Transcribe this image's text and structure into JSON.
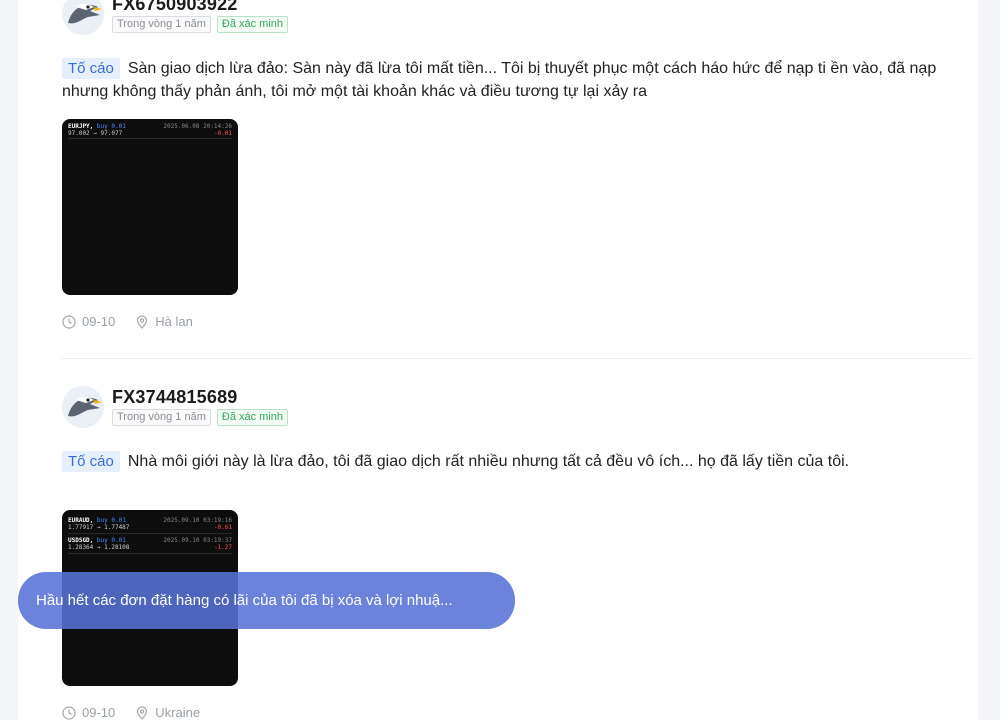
{
  "posts": [
    {
      "username": "FX6750903922",
      "tag_period": "Trong vòng 1 năm",
      "tag_verified": "Đã xác minh",
      "badge": "Tố cáo",
      "text": "Sàn giao dịch lừa đảo: Sàn này đã lừa tôi mất tiền... Tôi bị thuyết phục một cách háo hức để nạp ti ền vào, đã nạp nhưng không thấy phản ánh, tôi mở một tài khoản khác và điều tương tự lại xảy ra",
      "screenshot": {
        "rows": [
          {
            "symbol": "EURJPY,",
            "side": "buy 0.01",
            "prices": "97.002 → 97.077",
            "date": "2025.06.08 20:14:26",
            "pl": "-0.01"
          }
        ]
      },
      "date": "09-10",
      "location": "Hà lan"
    },
    {
      "username": "FX3744815689",
      "tag_period": "Trong vòng 1 năm",
      "tag_verified": "Đã xác minh",
      "badge": "Tố cáo",
      "text": "Nhà môi giới này là lừa đảo, tôi đã giao dịch rất nhiều nhưng tất cả đều vô ích... họ đã lấy tiền của tôi.",
      "screenshot": {
        "rows": [
          {
            "symbol": "EURAUD,",
            "side": "buy 0.01",
            "prices": "1.77917 → 1.77487",
            "date": "2025.09.10 03:19:16",
            "pl": "-0.61"
          },
          {
            "symbol": "USDSGD,",
            "side": "buy 0.01",
            "prices": "1.28364 → 1.28108",
            "date": "2025.09.10 03:19:37",
            "pl": "-1.27"
          }
        ]
      },
      "date": "09-10",
      "location": "Ukraine"
    }
  ],
  "toast": "Hầu hết các đơn đặt hàng có lãi của tôi đã bị xóa và lợi nhuậ...",
  "icons": {
    "clock": "clock-icon",
    "location": "location-pin-icon",
    "avatar": "eagle-avatar-icon"
  },
  "colors": {
    "badge_bg": "#e6effc",
    "badge_text": "#3a6fd1",
    "verified": "#37a65a",
    "toast": "#5872d6"
  }
}
